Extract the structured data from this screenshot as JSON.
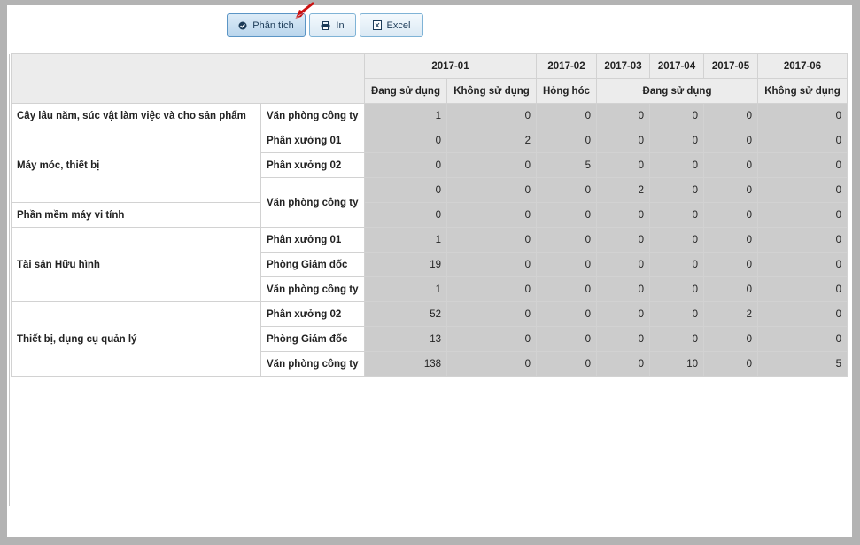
{
  "toolbar": {
    "analyze_label": "Phân tích",
    "print_label": "In",
    "excel_label": "Excel"
  },
  "columns": {
    "periods": [
      "2017-01",
      "2017-02",
      "2017-03",
      "2017-04",
      "2017-05",
      "2017-06"
    ],
    "statuses": [
      "Đang sử dụng",
      "Không sử dụng",
      "Hỏng hóc",
      "Đang sử dụng",
      "Không sử dụng"
    ]
  },
  "groups": [
    "Cây lâu năm, súc vật làm việc và cho sản phẩm",
    "Máy móc, thiết bị",
    "Phần mềm máy vi tính",
    "Tài sản Hữu hình",
    "Thiết bị, dụng cụ quản lý"
  ],
  "locations": [
    "Văn phòng công ty",
    "Phân xưởng 01",
    "Phân xưởng 02",
    "Văn phòng công ty",
    "Phân xưởng 01",
    "Phòng Giám đốc",
    "Văn phòng công ty",
    "Phân xưởng 02",
    "Phòng Giám đốc",
    "Văn phòng công ty"
  ],
  "rows": [
    [
      "1",
      "0",
      "0",
      "0",
      "0",
      "0",
      "0"
    ],
    [
      "0",
      "2",
      "0",
      "0",
      "0",
      "0",
      "0"
    ],
    [
      "0",
      "0",
      "5",
      "0",
      "0",
      "0",
      "0"
    ],
    [
      "0",
      "0",
      "0",
      "2",
      "0",
      "0",
      "0"
    ],
    [
      "0",
      "0",
      "0",
      "0",
      "0",
      "0",
      "0"
    ],
    [
      "1",
      "0",
      "0",
      "0",
      "0",
      "0",
      "0"
    ],
    [
      "19",
      "0",
      "0",
      "0",
      "0",
      "0",
      "0"
    ],
    [
      "1",
      "0",
      "0",
      "0",
      "0",
      "0",
      "0"
    ],
    [
      "52",
      "0",
      "0",
      "0",
      "0",
      "2",
      "0"
    ],
    [
      "13",
      "0",
      "0",
      "0",
      "0",
      "0",
      "0"
    ],
    [
      "138",
      "0",
      "0",
      "0",
      "10",
      "0",
      "5"
    ]
  ]
}
